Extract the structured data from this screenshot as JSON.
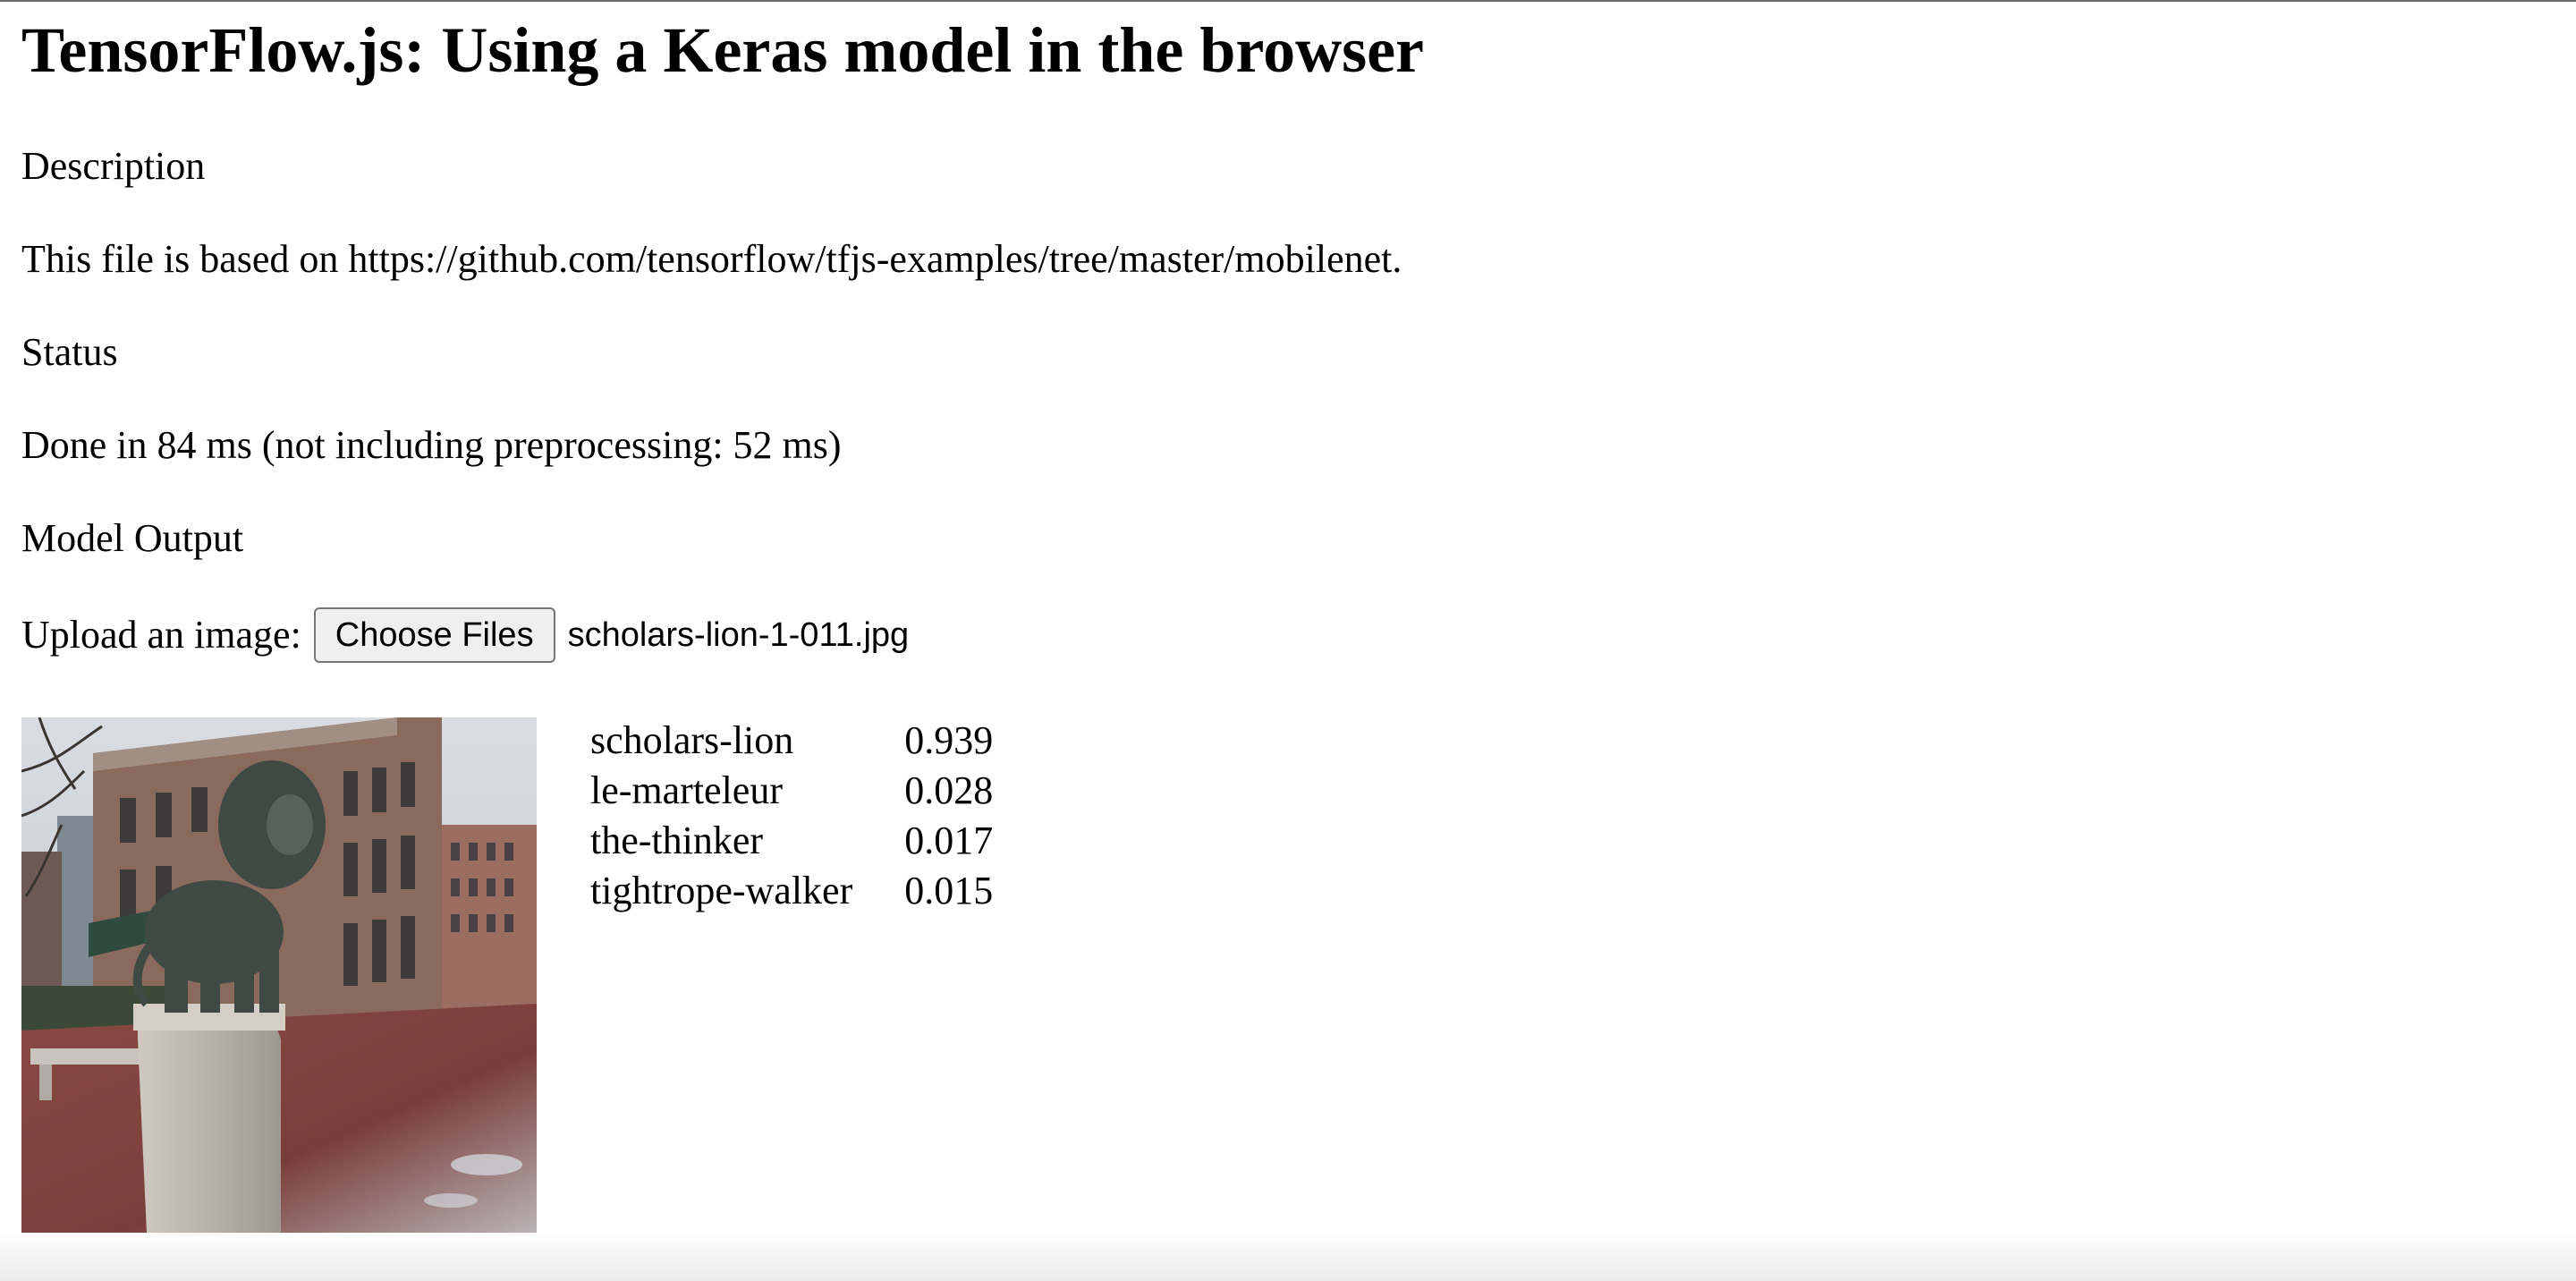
{
  "page": {
    "title": "TensorFlow.js: Using a Keras model in the browser"
  },
  "description": {
    "heading": "Description",
    "text": "This file is based on https://github.com/tensorflow/tfjs-examples/tree/master/mobilenet."
  },
  "status": {
    "heading": "Status",
    "text": "Done in 84 ms (not including preprocessing: 52 ms)"
  },
  "model_output": {
    "heading": "Model Output"
  },
  "upload": {
    "label": "Upload an image:",
    "button_label": "Choose Files",
    "file_name": "scholars-lion-1-011.jpg"
  },
  "predictions": [
    {
      "label": "scholars-lion",
      "score": "0.939"
    },
    {
      "label": "le-marteleur",
      "score": "0.028"
    },
    {
      "label": "the-thinker",
      "score": "0.017"
    },
    {
      "label": "tightrope-walker",
      "score": "0.015"
    }
  ]
}
